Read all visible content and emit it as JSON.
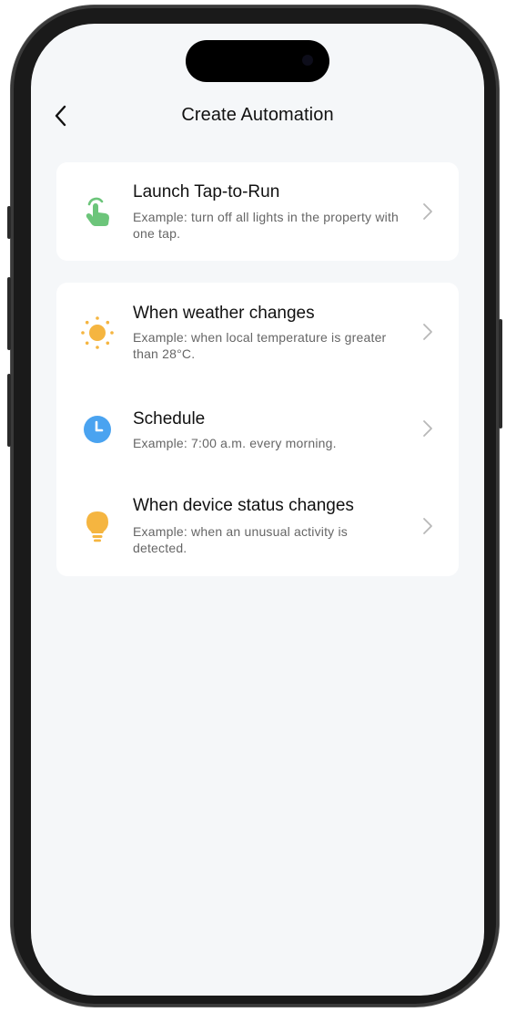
{
  "header": {
    "title": "Create Automation"
  },
  "cards": [
    {
      "items": [
        {
          "label": "Launch Tap-to-Run",
          "description": "Example: turn off all lights in the property with one tap.",
          "icon": "tap-hand-icon",
          "icon_color": "#6cc57a"
        }
      ]
    },
    {
      "items": [
        {
          "label": "When weather changes",
          "description": "Example: when local temperature is greater than 28°C.",
          "icon": "sun-icon",
          "icon_color": "#f5b540"
        },
        {
          "label": "Schedule",
          "description": "Example: 7:00 a.m. every morning.",
          "icon": "clock-icon",
          "icon_color": "#4aa3f0"
        },
        {
          "label": "When device status changes",
          "description": "Example: when an unusual activity is detected.",
          "icon": "lightbulb-icon",
          "icon_color": "#f5b540"
        }
      ]
    }
  ]
}
